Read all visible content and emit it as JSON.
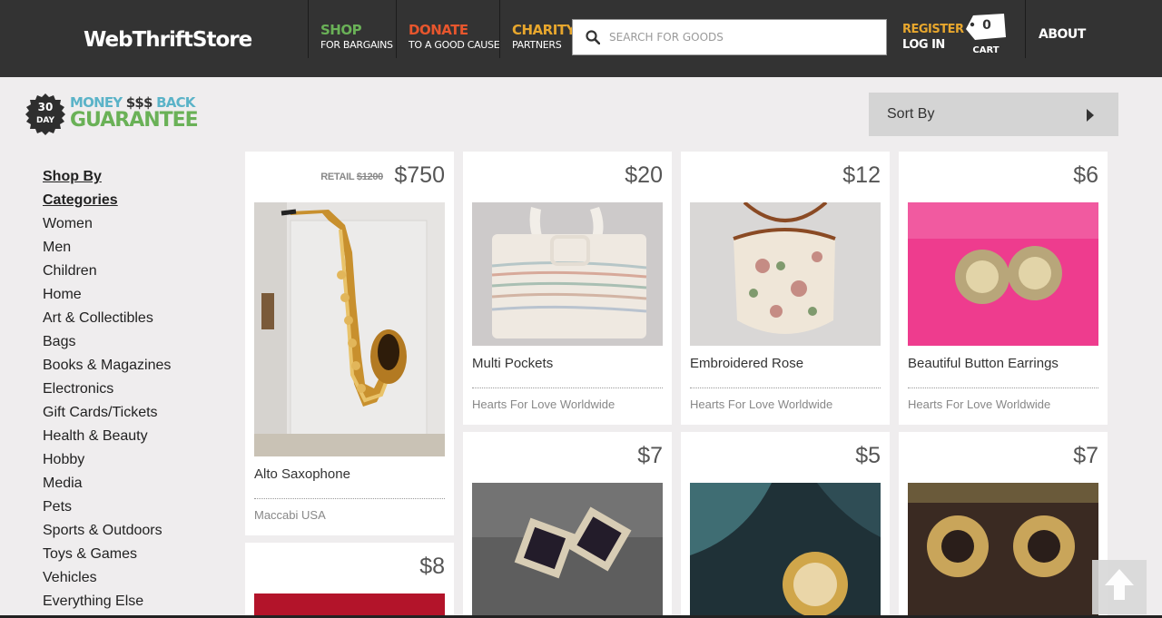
{
  "header": {
    "logo": "WebThriftStore",
    "nav": [
      {
        "big": "SHOP",
        "small": "FOR BARGAINS",
        "color": "#6ab157"
      },
      {
        "big": "DONATE",
        "small": "TO A GOOD CAUSE",
        "color": "#e8562d"
      },
      {
        "big": "CHARITY",
        "small": "PARTNERS",
        "color": "#e8a72d"
      }
    ],
    "search_placeholder": "SEARCH FOR GOODS",
    "register": "REGISTER",
    "login": "LOG IN",
    "cart_count": "0",
    "cart_label": "CART",
    "about": "ABOUT",
    "icons": {
      "search": "search-icon",
      "cart": "cart-tag-icon"
    }
  },
  "guarantee": {
    "days": "30",
    "day_label": "DAY",
    "line1_a": "MONEY",
    "line1_b": "$$$",
    "line1_c": "BACK",
    "line2": "GUARANTEE"
  },
  "sort": {
    "label": "Sort By"
  },
  "sidebar": {
    "heading1": "Shop By",
    "heading2": "Categories",
    "items": [
      "Women",
      "Men",
      "Children",
      "Home",
      "Art & Collectibles",
      "Bags",
      "Books & Magazines",
      "Electronics",
      "Gift Cards/Tickets",
      "Health & Beauty",
      "Hobby",
      "Media",
      "Pets",
      "Sports & Outdoors",
      "Toys & Games",
      "Vehicles",
      "Everything Else"
    ]
  },
  "products": [
    {
      "price": "$750",
      "retail_label": "RETAIL",
      "retail_price": "$1200",
      "title": "Alto Saxophone",
      "charity": "Maccabi USA"
    },
    {
      "price": "$20",
      "title": "Multi Pockets",
      "charity": "Hearts For Love Worldwide"
    },
    {
      "price": "$12",
      "title": "Embroidered Rose",
      "charity": "Hearts For Love Worldwide"
    },
    {
      "price": "$6",
      "title": "Beautiful Button Earrings",
      "charity": "Hearts For Love Worldwide"
    },
    {
      "price": "$8"
    },
    {
      "price": "$7"
    },
    {
      "price": "$5"
    },
    {
      "price": "$7"
    }
  ],
  "scroll_top_icon": "arrow-up-icon"
}
